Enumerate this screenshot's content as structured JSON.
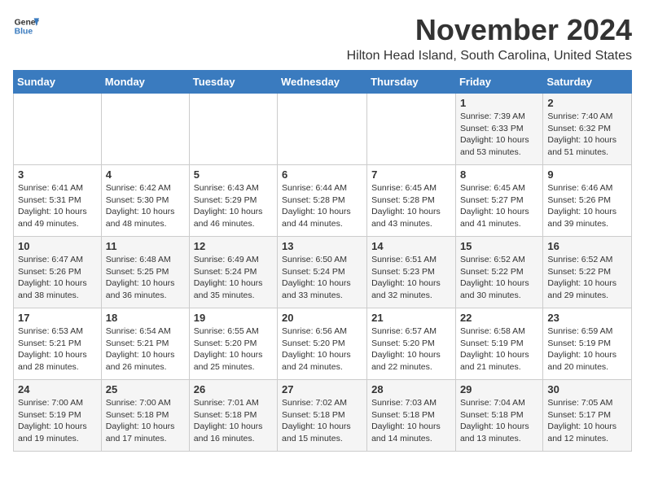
{
  "header": {
    "logo_general": "General",
    "logo_blue": "Blue",
    "month_title": "November 2024",
    "location": "Hilton Head Island, South Carolina, United States"
  },
  "days_of_week": [
    "Sunday",
    "Monday",
    "Tuesday",
    "Wednesday",
    "Thursday",
    "Friday",
    "Saturday"
  ],
  "weeks": [
    [
      {
        "day": "",
        "info": ""
      },
      {
        "day": "",
        "info": ""
      },
      {
        "day": "",
        "info": ""
      },
      {
        "day": "",
        "info": ""
      },
      {
        "day": "",
        "info": ""
      },
      {
        "day": "1",
        "info": "Sunrise: 7:39 AM\nSunset: 6:33 PM\nDaylight: 10 hours\nand 53 minutes."
      },
      {
        "day": "2",
        "info": "Sunrise: 7:40 AM\nSunset: 6:32 PM\nDaylight: 10 hours\nand 51 minutes."
      }
    ],
    [
      {
        "day": "3",
        "info": "Sunrise: 6:41 AM\nSunset: 5:31 PM\nDaylight: 10 hours\nand 49 minutes."
      },
      {
        "day": "4",
        "info": "Sunrise: 6:42 AM\nSunset: 5:30 PM\nDaylight: 10 hours\nand 48 minutes."
      },
      {
        "day": "5",
        "info": "Sunrise: 6:43 AM\nSunset: 5:29 PM\nDaylight: 10 hours\nand 46 minutes."
      },
      {
        "day": "6",
        "info": "Sunrise: 6:44 AM\nSunset: 5:28 PM\nDaylight: 10 hours\nand 44 minutes."
      },
      {
        "day": "7",
        "info": "Sunrise: 6:45 AM\nSunset: 5:28 PM\nDaylight: 10 hours\nand 43 minutes."
      },
      {
        "day": "8",
        "info": "Sunrise: 6:45 AM\nSunset: 5:27 PM\nDaylight: 10 hours\nand 41 minutes."
      },
      {
        "day": "9",
        "info": "Sunrise: 6:46 AM\nSunset: 5:26 PM\nDaylight: 10 hours\nand 39 minutes."
      }
    ],
    [
      {
        "day": "10",
        "info": "Sunrise: 6:47 AM\nSunset: 5:26 PM\nDaylight: 10 hours\nand 38 minutes."
      },
      {
        "day": "11",
        "info": "Sunrise: 6:48 AM\nSunset: 5:25 PM\nDaylight: 10 hours\nand 36 minutes."
      },
      {
        "day": "12",
        "info": "Sunrise: 6:49 AM\nSunset: 5:24 PM\nDaylight: 10 hours\nand 35 minutes."
      },
      {
        "day": "13",
        "info": "Sunrise: 6:50 AM\nSunset: 5:24 PM\nDaylight: 10 hours\nand 33 minutes."
      },
      {
        "day": "14",
        "info": "Sunrise: 6:51 AM\nSunset: 5:23 PM\nDaylight: 10 hours\nand 32 minutes."
      },
      {
        "day": "15",
        "info": "Sunrise: 6:52 AM\nSunset: 5:22 PM\nDaylight: 10 hours\nand 30 minutes."
      },
      {
        "day": "16",
        "info": "Sunrise: 6:52 AM\nSunset: 5:22 PM\nDaylight: 10 hours\nand 29 minutes."
      }
    ],
    [
      {
        "day": "17",
        "info": "Sunrise: 6:53 AM\nSunset: 5:21 PM\nDaylight: 10 hours\nand 28 minutes."
      },
      {
        "day": "18",
        "info": "Sunrise: 6:54 AM\nSunset: 5:21 PM\nDaylight: 10 hours\nand 26 minutes."
      },
      {
        "day": "19",
        "info": "Sunrise: 6:55 AM\nSunset: 5:20 PM\nDaylight: 10 hours\nand 25 minutes."
      },
      {
        "day": "20",
        "info": "Sunrise: 6:56 AM\nSunset: 5:20 PM\nDaylight: 10 hours\nand 24 minutes."
      },
      {
        "day": "21",
        "info": "Sunrise: 6:57 AM\nSunset: 5:20 PM\nDaylight: 10 hours\nand 22 minutes."
      },
      {
        "day": "22",
        "info": "Sunrise: 6:58 AM\nSunset: 5:19 PM\nDaylight: 10 hours\nand 21 minutes."
      },
      {
        "day": "23",
        "info": "Sunrise: 6:59 AM\nSunset: 5:19 PM\nDaylight: 10 hours\nand 20 minutes."
      }
    ],
    [
      {
        "day": "24",
        "info": "Sunrise: 7:00 AM\nSunset: 5:19 PM\nDaylight: 10 hours\nand 19 minutes."
      },
      {
        "day": "25",
        "info": "Sunrise: 7:00 AM\nSunset: 5:18 PM\nDaylight: 10 hours\nand 17 minutes."
      },
      {
        "day": "26",
        "info": "Sunrise: 7:01 AM\nSunset: 5:18 PM\nDaylight: 10 hours\nand 16 minutes."
      },
      {
        "day": "27",
        "info": "Sunrise: 7:02 AM\nSunset: 5:18 PM\nDaylight: 10 hours\nand 15 minutes."
      },
      {
        "day": "28",
        "info": "Sunrise: 7:03 AM\nSunset: 5:18 PM\nDaylight: 10 hours\nand 14 minutes."
      },
      {
        "day": "29",
        "info": "Sunrise: 7:04 AM\nSunset: 5:18 PM\nDaylight: 10 hours\nand 13 minutes."
      },
      {
        "day": "30",
        "info": "Sunrise: 7:05 AM\nSunset: 5:17 PM\nDaylight: 10 hours\nand 12 minutes."
      }
    ]
  ]
}
